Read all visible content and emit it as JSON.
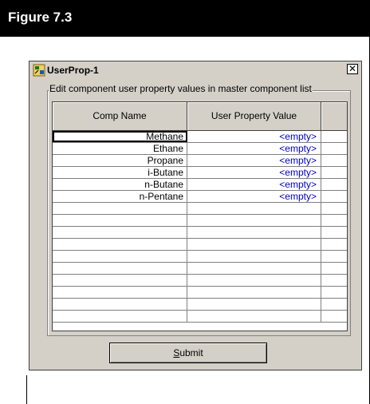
{
  "figure": {
    "title": "Figure 7.3"
  },
  "window": {
    "title": "UserProp-1",
    "close_glyph": "✕",
    "group_label": "Edit component user property values in master component list"
  },
  "grid": {
    "columns": [
      "Comp Name",
      "User Property Value",
      ""
    ],
    "rows": [
      {
        "name": "Methane",
        "value": "<empty>"
      },
      {
        "name": "Ethane",
        "value": "<empty>"
      },
      {
        "name": "Propane",
        "value": "<empty>"
      },
      {
        "name": "i-Butane",
        "value": "<empty>"
      },
      {
        "name": "n-Butane",
        "value": "<empty>"
      },
      {
        "name": "n-Pentane",
        "value": "<empty>"
      },
      {
        "name": "",
        "value": ""
      },
      {
        "name": "",
        "value": ""
      },
      {
        "name": "",
        "value": ""
      },
      {
        "name": "",
        "value": ""
      },
      {
        "name": "",
        "value": ""
      },
      {
        "name": "",
        "value": ""
      },
      {
        "name": "",
        "value": ""
      },
      {
        "name": "",
        "value": ""
      },
      {
        "name": "",
        "value": ""
      },
      {
        "name": "",
        "value": ""
      }
    ]
  },
  "submit": {
    "accel": "S",
    "rest": "ubmit"
  },
  "colors": {
    "value_text": "#0000cc",
    "window_bg": "#d4d0c8"
  }
}
